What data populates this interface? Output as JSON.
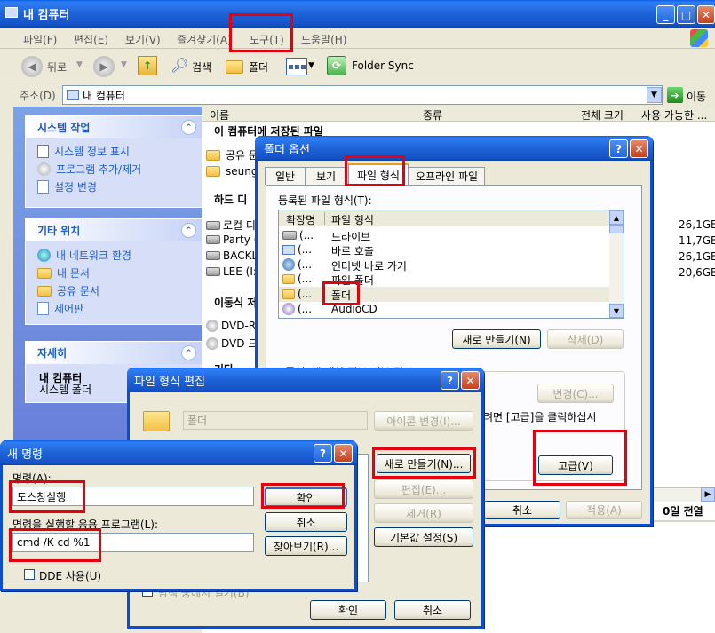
{
  "explorer": {
    "title": "내 컴퓨터",
    "menu": [
      "파일(F)",
      "편집(E)",
      "보기(V)",
      "즐겨찾기(A)",
      "도구(T)",
      "도움말(H)"
    ],
    "toolbar": {
      "back": "뒤로",
      "search": "검색",
      "folders": "폴더",
      "folder_sync": "Folder Sync"
    },
    "address": {
      "label": "주소(D)",
      "value": "내 컴퓨터",
      "go": "이동"
    },
    "columns": [
      "이름",
      "종류",
      "전체 크기",
      "사용 가능한 ..."
    ],
    "sections": {
      "stored": "이 컴퓨터에 저장된 파일",
      "hard": "하드 디",
      "removable": "이동식 저",
      "other": "기타"
    },
    "stored_items": [
      "공유 문",
      "seungy"
    ],
    "hard_items": [
      "로컬 디",
      "Party (",
      "BACKL",
      "LEE (I:"
    ],
    "removable_items": [
      "DVD-R",
      "DVD 드"
    ],
    "sizes_total": [
      "26,1GB",
      "11,7GB",
      "26,1GB",
      "20,6GB"
    ],
    "status_right": "0일 전열",
    "tasks": {
      "system_title": "시스템 작업",
      "system_items": [
        "시스템 정보 표시",
        "프로그램 추가/제거",
        "설정 변경"
      ],
      "other_title": "기타 위치",
      "other_items": [
        "내 네트워크 환경",
        "내 문서",
        "공유 문서",
        "제어판"
      ],
      "detail_title": "자세히",
      "detail_name": "내 컴퓨터",
      "detail_sub": "시스템 폴더"
    }
  },
  "folder_options": {
    "title": "폴더 옵션",
    "tabs": [
      "일반",
      "보기",
      "파일 형식",
      "오프라인 파일"
    ],
    "registered_label": "등록된 파일 형식(T):",
    "col_ext": "확장명",
    "col_type": "파일 형식",
    "rows": [
      {
        "ext": "(...",
        "type": "드라이브"
      },
      {
        "ext": "(...",
        "type": "바로 호출"
      },
      {
        "ext": "(...",
        "type": "인터넷 바로 가기"
      },
      {
        "ext": "(...",
        "type": "파일 폴더"
      },
      {
        "ext": "(...",
        "type": "폴더"
      },
      {
        "ext": "(...",
        "type": "AudioCD"
      }
    ],
    "new_button": "새로 만들기(N)",
    "delete_button": "삭제(D)",
    "partial_text": "'폴더' 에 대한 정보 세부 정보",
    "change_button": "변경(C)...",
    "advanced_hint": "려면 [고급]을 클릭하십시",
    "advanced_button": "고급(V)",
    "cancel_button": "취소",
    "apply_button": "적용(A)"
  },
  "edit_type": {
    "title": "파일 형식 편집",
    "name_value": "폴더",
    "change_icon_button": "아이콘 변경(I)...",
    "new_button": "새로 만들기(N)...",
    "edit_button": "편집(E)...",
    "remove_button": "제거(R)",
    "default_button": "기본값 설정(S)",
    "check_text": "탐색 중에서 열기(B)",
    "ok_button": "확인",
    "cancel_button": "취소"
  },
  "new_action": {
    "title": "새 명령",
    "action_label": "명령(A):",
    "action_value": "도스창실행",
    "app_label": "명령을 실행할 응용 프로그램(L):",
    "app_value": "cmd /K cd %1",
    "ok_button": "확인",
    "cancel_button": "취소",
    "browse_button": "찾아보기(R)...",
    "dde_label": "DDE 사용(U)"
  }
}
